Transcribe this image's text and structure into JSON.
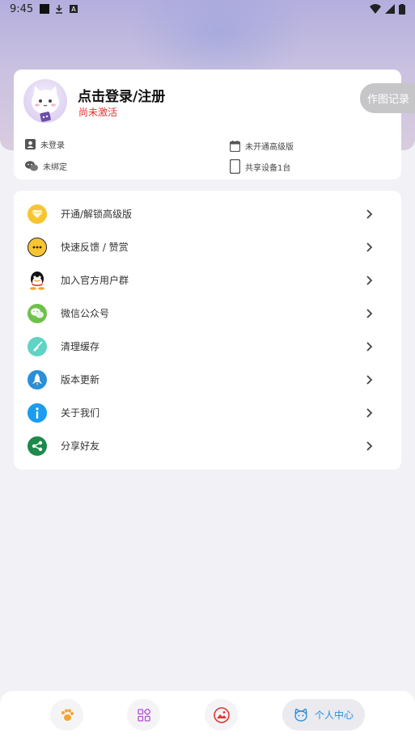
{
  "status_bar": {
    "time": "9:45"
  },
  "profile": {
    "login_title": "点击登录/注册",
    "activation_status": "尚未激活",
    "info": {
      "login_state": "未登录",
      "premium_state": "未开通高级版",
      "wechat_state": "未绑定",
      "device_share": "共享设备1台"
    }
  },
  "record_button": {
    "label": "作图记录"
  },
  "menu": {
    "items": [
      {
        "label": "开通/解锁高级版",
        "icon": "diamond-icon",
        "color": "#f7c531"
      },
      {
        "label": "快速反馈 / 赞赏",
        "icon": "feedback-icon",
        "color": "#f7c531"
      },
      {
        "label": "加入官方用户群",
        "icon": "qq-icon",
        "color": "#111111"
      },
      {
        "label": "微信公众号",
        "icon": "wechat-icon",
        "color": "#6cc24a"
      },
      {
        "label": "清理缓存",
        "icon": "broom-icon",
        "color": "#5fd3c4"
      },
      {
        "label": "版本更新",
        "icon": "rocket-icon",
        "color": "#2a8fd8"
      },
      {
        "label": "关于我们",
        "icon": "info-icon",
        "color": "#1a9cf0"
      },
      {
        "label": "分享好友",
        "icon": "share-icon",
        "color": "#1b8a4a"
      }
    ]
  },
  "bottom_nav": {
    "items": [
      {
        "icon": "paw-icon"
      },
      {
        "icon": "grid-icon"
      },
      {
        "icon": "image-icon"
      },
      {
        "icon": "cat-icon",
        "label": "个人中心",
        "active": true
      }
    ]
  },
  "colors": {
    "accent": "#2a8fd8",
    "warning": "#e0332e"
  }
}
